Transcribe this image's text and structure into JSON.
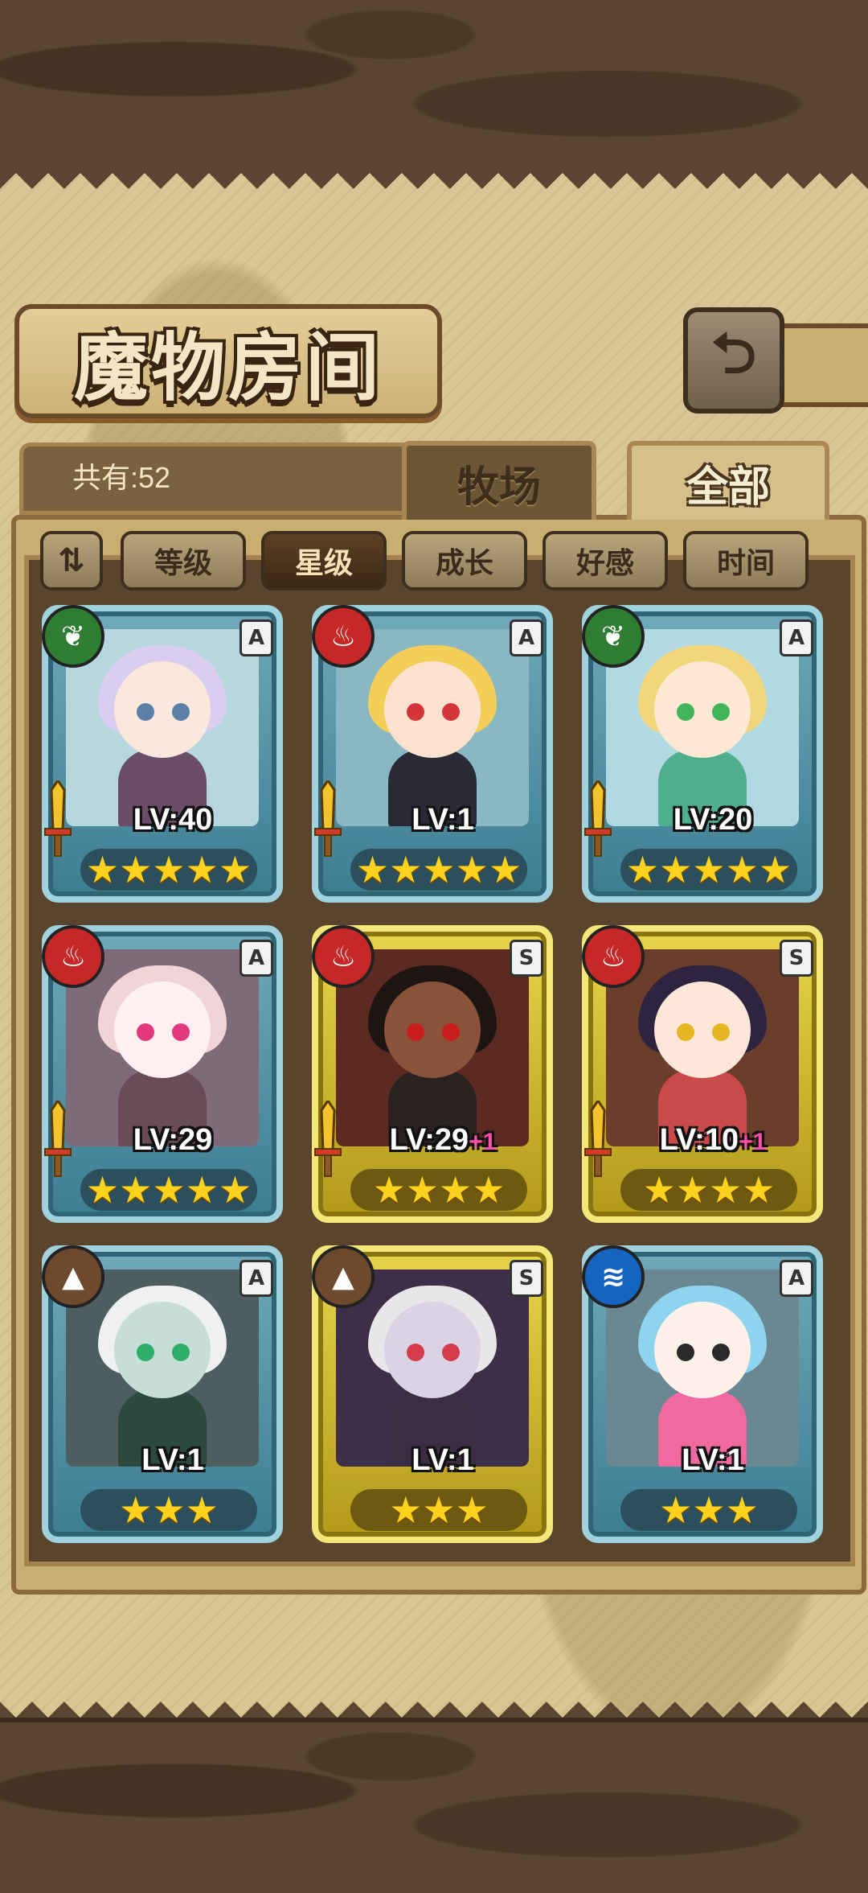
{
  "screen": {
    "title": "魔物房间",
    "back_icon": "back-arrow-icon",
    "count_label": "共有:52",
    "tabs": [
      {
        "label": "牧场",
        "active": false
      },
      {
        "label": "全部",
        "active": true
      }
    ],
    "sort_buttons": [
      {
        "label": "等级",
        "active": false
      },
      {
        "label": "星级",
        "active": true
      },
      {
        "label": "成长",
        "active": false
      },
      {
        "label": "好感",
        "active": false
      },
      {
        "label": "时间",
        "active": false
      }
    ]
  },
  "monsters": [
    {
      "element": "leaf",
      "rank": "A",
      "level": "LV:40",
      "plus": "",
      "stars": 5,
      "colors": {
        "hair": "#d9cdf0",
        "skin": "#fbe8dc",
        "body": "#6b4d6a",
        "eye": "#5b7fa6",
        "bg": "#b7d7df"
      }
    },
    {
      "element": "fire",
      "rank": "A",
      "level": "LV:1",
      "plus": "",
      "stars": 5,
      "colors": {
        "hair": "#f3cf5a",
        "skin": "#fde3cf",
        "body": "#2a2a36",
        "eye": "#d3363a",
        "bg": "#8ab7c4"
      }
    },
    {
      "element": "leaf",
      "rank": "A",
      "level": "LV:20",
      "plus": "",
      "stars": 5,
      "colors": {
        "hair": "#f2d67b",
        "skin": "#fde8d3",
        "body": "#4fae8d",
        "eye": "#3fb45a",
        "bg": "#b2d9e2"
      }
    },
    {
      "element": "fire",
      "rank": "A",
      "level": "LV:29",
      "plus": "",
      "stars": 5,
      "colors": {
        "hair": "#f1d4d8",
        "skin": "#fff0f2",
        "body": "#6a4b58",
        "eye": "#e0397e",
        "bg": "#7f6a78"
      }
    },
    {
      "element": "fire",
      "rank": "S",
      "level": "LV:29",
      "plus": "+1",
      "stars": 4,
      "colors": {
        "hair": "#1c1512",
        "skin": "#8a5238",
        "body": "#2a2220",
        "eye": "#c91d1d",
        "bg": "#5c2a22"
      }
    },
    {
      "element": "fire",
      "rank": "S",
      "level": "LV:10",
      "plus": "+1",
      "stars": 4,
      "colors": {
        "hair": "#2d2440",
        "skin": "#fde7d8",
        "body": "#c84a4a",
        "eye": "#e5b622",
        "bg": "#6a3e2a"
      }
    },
    {
      "element": "earth",
      "rank": "A",
      "level": "LV:1",
      "plus": "",
      "stars": 3,
      "colors": {
        "hair": "#eef0f2",
        "skin": "#c7ded6",
        "body": "#2b4a3d",
        "eye": "#2fae6a",
        "bg": "#4d5d60"
      }
    },
    {
      "element": "earth",
      "rank": "S",
      "level": "LV:1",
      "plus": "",
      "stars": 3,
      "colors": {
        "hair": "#e9e6ea",
        "skin": "#d9d3e3",
        "body": "#3a2d44",
        "eye": "#d43c4a",
        "bg": "#3d2f48"
      }
    },
    {
      "element": "water",
      "rank": "A",
      "level": "LV:1",
      "plus": "",
      "stars": 3,
      "colors": {
        "hair": "#8fd4ef",
        "skin": "#fef1ea",
        "body": "#f06aa0",
        "eye": "#2a2a2a",
        "bg": "#6b8791"
      }
    }
  ],
  "element_styles": {
    "leaf": {
      "color": "#2e7d32",
      "glyph": "❦",
      "icon": "leaf-icon"
    },
    "fire": {
      "color": "#c62828",
      "glyph": "♨",
      "icon": "fire-icon"
    },
    "earth": {
      "color": "#6d4a2e",
      "glyph": "▲",
      "icon": "mountain-icon"
    },
    "water": {
      "color": "#1565c0",
      "glyph": "≋",
      "icon": "water-icon"
    }
  }
}
